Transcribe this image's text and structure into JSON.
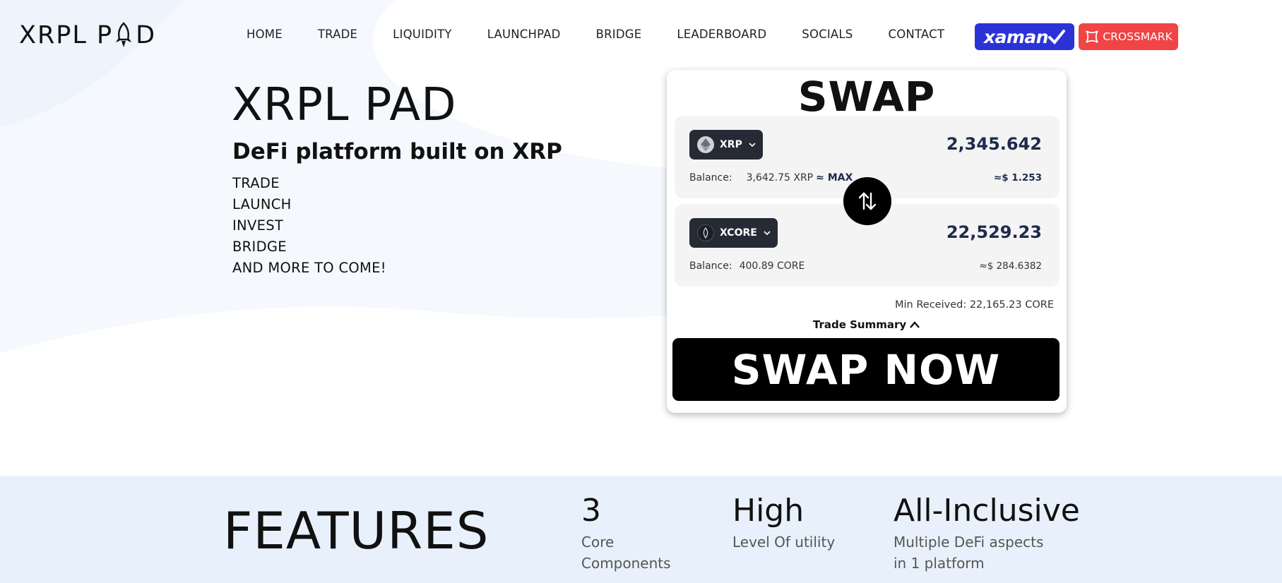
{
  "header": {
    "logo": "XRPL PAD",
    "logo_parts": [
      "XRPL P",
      "D"
    ],
    "nav": [
      "HOME",
      "TRADE",
      "LIQUIDITY",
      "LAUNCHPAD",
      "BRIDGE",
      "LEADERBOARD",
      "SOCIALS",
      "CONTACT"
    ],
    "xaman_label": "xaman",
    "crossmark_label": "CROSSMARK"
  },
  "hero": {
    "title": "XRPL PAD",
    "subtitle": "DeFi platform built on XRP",
    "list": [
      "TRADE",
      "LAUNCH",
      "INVEST",
      "BRIDGE",
      "AND MORE TO COME!"
    ]
  },
  "swap": {
    "title": "SWAP",
    "from": {
      "token": "XRP",
      "amount": "2,345.642",
      "balance_label": "Balance:",
      "balance_value": "3,642.75 XRP",
      "max_label": "≈ MAX",
      "usd": "≈$ 1.253"
    },
    "to": {
      "token": "XCORE",
      "amount": "22,529.23",
      "balance_label": "Balance:",
      "balance_value": "400.89 CORE",
      "usd": "≈$ 284.6382"
    },
    "min_received": "Min Received:  22,165.23 CORE",
    "trade_summary": "Trade Summary",
    "button": "SWAP NOW"
  },
  "features": {
    "title": "FEATURES",
    "items": [
      {
        "big": "3",
        "small": [
          "Core",
          "Components"
        ]
      },
      {
        "big": "High",
        "small": [
          "Level Of utility"
        ]
      },
      {
        "big": "All-Inclusive",
        "small": [
          "Multiple DeFi aspects",
          "in 1 platform"
        ]
      }
    ]
  },
  "colors": {
    "xaman": "#2b33d6",
    "crossmark": "#f04445",
    "features_bg": "#e8f1fb",
    "amount_text": "#1f2a4d"
  }
}
